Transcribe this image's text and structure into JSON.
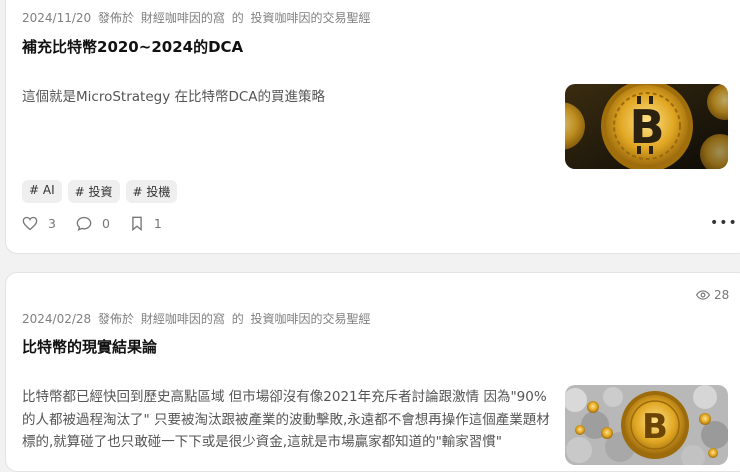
{
  "posts": [
    {
      "date": "2024/11/20",
      "posted_in": "發佈於",
      "publication": "財經咖啡因的窩",
      "of": "的",
      "column": "投資咖啡因的交易聖經",
      "title": "補充比特幣2020~2024的DCA",
      "excerpt": "這個就是MicroStrategy 在比特幣DCA的買進策略",
      "tags": [
        "# AI",
        "# 投資",
        "# 投機"
      ],
      "likes": "3",
      "comments": "0",
      "saves": "1",
      "thumbnail_icon": "bitcoin-coin-image"
    },
    {
      "views": "28",
      "date": "2024/02/28",
      "posted_in": "發佈於",
      "publication": "財經咖啡因的窩",
      "of": "的",
      "column": "投資咖啡因的交易聖經",
      "title": "比特幣的現實結果論",
      "excerpt": "比特幣都已經快回到歷史高點區域 但市場卻沒有像2021年充斥者討論跟激情 因為\"90%的人都被過程淘汰了\" 只要被淘汰跟被產業的波動擊敗,永遠都不會想再操作這個產業題材標的,就算碰了也只敢碰一下下或是很少資金,這就是市場贏家都知道的\"輸家習慣\"",
      "thumbnail_icon": "bitcoin-coins-pile-image"
    }
  ],
  "colors": {
    "gold": "#d9a21b",
    "dark": "#2a2a2a",
    "meta": "#808080"
  }
}
